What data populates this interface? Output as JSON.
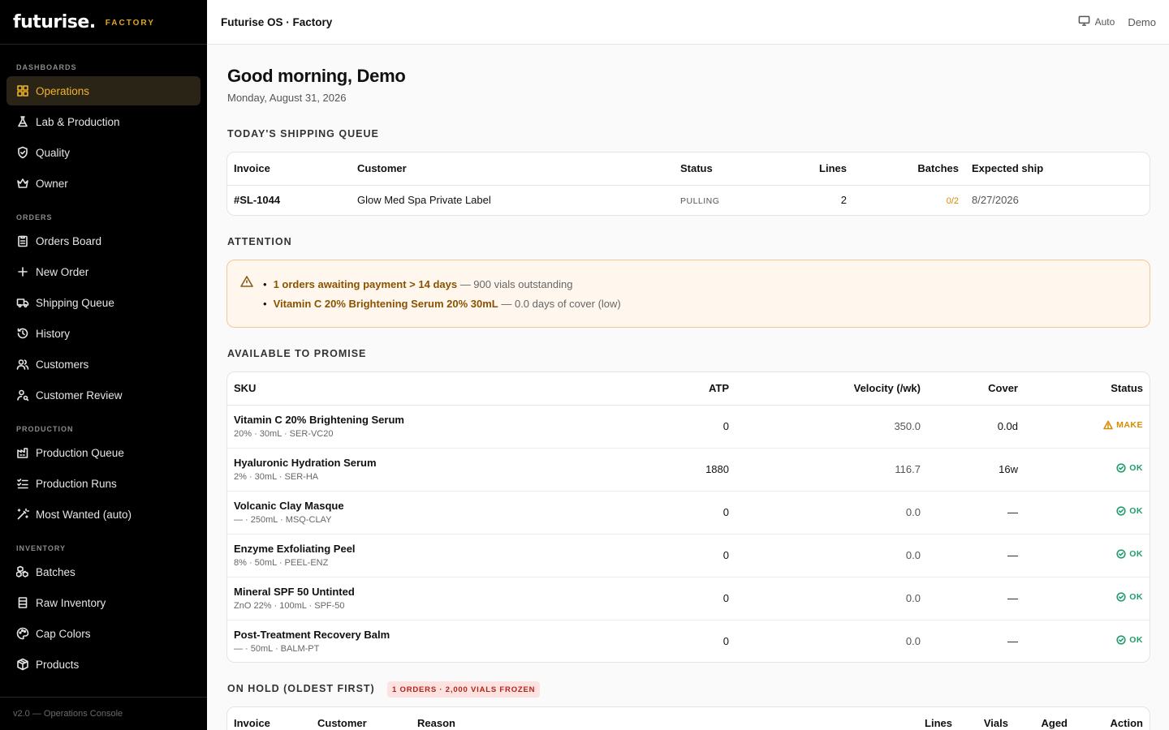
{
  "brand": {
    "logo": "futurise.",
    "tag": "FACTORY"
  },
  "sidebar": {
    "sections": [
      {
        "label": "DASHBOARDS",
        "items": [
          {
            "label": "Operations",
            "icon": "grid-icon",
            "active": true
          },
          {
            "label": "Lab & Production",
            "icon": "flask-icon"
          },
          {
            "label": "Quality",
            "icon": "shield-check-icon"
          },
          {
            "label": "Owner",
            "icon": "crown-icon"
          }
        ]
      },
      {
        "label": "ORDERS",
        "items": [
          {
            "label": "Orders Board",
            "icon": "clipboard-icon"
          },
          {
            "label": "New Order",
            "icon": "plus-icon"
          },
          {
            "label": "Shipping Queue",
            "icon": "truck-icon"
          },
          {
            "label": "History",
            "icon": "history-icon"
          },
          {
            "label": "Customers",
            "icon": "users-icon"
          },
          {
            "label": "Customer Review",
            "icon": "user-review-icon"
          }
        ]
      },
      {
        "label": "PRODUCTION",
        "items": [
          {
            "label": "Production Queue",
            "icon": "factory-icon"
          },
          {
            "label": "Production Runs",
            "icon": "list-checks-icon"
          },
          {
            "label": "Most Wanted (auto)",
            "icon": "wand-icon"
          }
        ]
      },
      {
        "label": "INVENTORY",
        "items": [
          {
            "label": "Batches",
            "icon": "boxes-icon"
          },
          {
            "label": "Raw Inventory",
            "icon": "container-icon"
          },
          {
            "label": "Cap Colors",
            "icon": "palette-icon"
          },
          {
            "label": "Products",
            "icon": "package-icon"
          }
        ]
      }
    ],
    "footer": "v2.0 — Operations Console"
  },
  "topbar": {
    "title": "Futurise OS · Factory",
    "mode": "Auto",
    "user": "Demo"
  },
  "main": {
    "greeting": "Good morning, Demo",
    "date": "Monday, August 31, 2026",
    "shipping": {
      "title": "TODAY'S SHIPPING QUEUE",
      "columns": [
        "Invoice",
        "Customer",
        "Status",
        "Lines",
        "Batches",
        "Expected ship"
      ],
      "rows": [
        {
          "invoice": "#SL-1044",
          "customer": "Glow Med Spa Private Label",
          "status": "PULLING",
          "lines": "2",
          "batches": "0/2",
          "ship": "8/27/2026"
        }
      ]
    },
    "attention": {
      "title": "ATTENTION",
      "alerts": [
        {
          "link": "1 orders awaiting payment > 14 days",
          "text": " — 900 vials outstanding"
        },
        {
          "link": "Vitamin C 20% Brightening Serum 20% 30mL",
          "text": " — 0.0 days of cover (low)"
        }
      ]
    },
    "atp": {
      "title": "AVAILABLE TO PROMISE",
      "columns": [
        "SKU",
        "ATP",
        "Velocity (/wk)",
        "Cover",
        "Status"
      ],
      "rows": [
        {
          "name": "Vitamin C 20% Brightening Serum",
          "meta": "20% · 30mL · SER-VC20",
          "atp": "0",
          "velocity": "350.0",
          "cover": "0.0d",
          "status": "MAKE",
          "kind": "make"
        },
        {
          "name": "Hyaluronic Hydration Serum",
          "meta": "2% · 30mL · SER-HA",
          "atp": "1880",
          "velocity": "116.7",
          "cover": "16w",
          "status": "OK",
          "kind": "ok"
        },
        {
          "name": "Volcanic Clay Masque",
          "meta": "— · 250mL · MSQ-CLAY",
          "atp": "0",
          "velocity": "0.0",
          "cover": "—",
          "status": "OK",
          "kind": "ok"
        },
        {
          "name": "Enzyme Exfoliating Peel",
          "meta": "8% · 50mL · PEEL-ENZ",
          "atp": "0",
          "velocity": "0.0",
          "cover": "—",
          "status": "OK",
          "kind": "ok"
        },
        {
          "name": "Mineral SPF 50 Untinted",
          "meta": "ZnO 22% · 100mL · SPF-50",
          "atp": "0",
          "velocity": "0.0",
          "cover": "—",
          "status": "OK",
          "kind": "ok"
        },
        {
          "name": "Post-Treatment Recovery Balm",
          "meta": "— · 50mL · BALM-PT",
          "atp": "0",
          "velocity": "0.0",
          "cover": "—",
          "status": "OK",
          "kind": "ok"
        }
      ]
    },
    "hold": {
      "title": "ON HOLD (OLDEST FIRST)",
      "badge": "1 ORDERS · 2,000 VIALS FROZEN",
      "columns": [
        "Invoice",
        "Customer",
        "Reason",
        "Lines",
        "Vials",
        "Aged",
        "Action"
      ]
    }
  },
  "colors": {
    "accent": "#f0b429",
    "warn": "#d98a00",
    "ok": "#1f9d6b",
    "danger": "#b42318"
  }
}
